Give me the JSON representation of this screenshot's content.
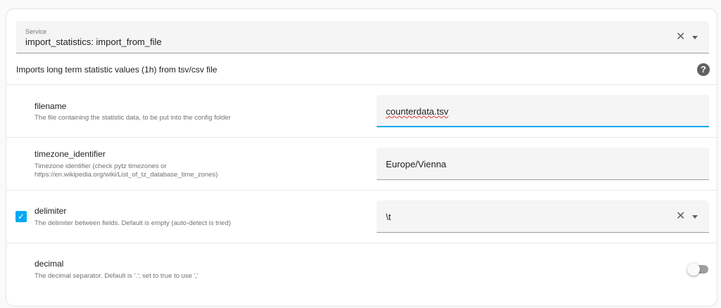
{
  "service": {
    "label": "Service",
    "value": "import_statistics: import_from_file"
  },
  "description": "Imports long term statistic values (1h) from tsv/csv file",
  "fields": [
    {
      "name": "filename",
      "description": "The file containing the statistic data, to be put into the config folder",
      "value": "counterdata.tsv"
    },
    {
      "name": "timezone_identifier",
      "description_line1": "Timezone identifier (check pytz timezones or",
      "description_line2": "https://en.wikipedia.org/wiki/List_of_tz_database_time_zones)",
      "value": "Europe/Vienna"
    },
    {
      "name": "delimiter",
      "description": "The delimiter between fields. Default is empty (auto-detect is tried)",
      "value": "\\t",
      "enabled": true
    },
    {
      "name": "decimal",
      "description": "The decimal separator. Default is '.'; set to true to use ','",
      "value": false
    }
  ],
  "colors": {
    "accent": "#03a9f4"
  }
}
